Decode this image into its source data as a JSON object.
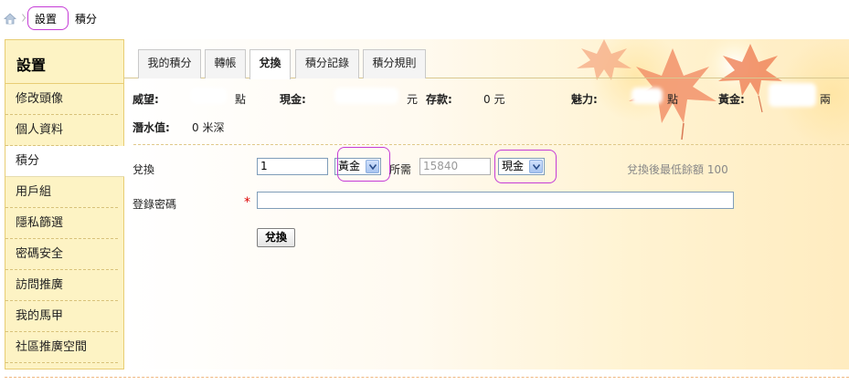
{
  "breadcrumb": {
    "items": [
      "設置",
      "積分"
    ]
  },
  "sidebar": {
    "title": "設置",
    "items": [
      {
        "label": "修改頭像"
      },
      {
        "label": "個人資料"
      },
      {
        "label": "積分",
        "active": true
      },
      {
        "label": "用戶組"
      },
      {
        "label": "隱私篩選"
      },
      {
        "label": "密碼安全"
      },
      {
        "label": "訪問推廣"
      },
      {
        "label": "我的馬甲"
      },
      {
        "label": "社區推廣空間"
      }
    ]
  },
  "tabs": [
    {
      "label": "我的積分"
    },
    {
      "label": "轉帳"
    },
    {
      "label": "兌換",
      "active": true
    },
    {
      "label": "積分記錄"
    },
    {
      "label": "積分規則"
    }
  ],
  "stats": {
    "weiwang_label": "威望:",
    "weiwang_unit": "點",
    "xianjin_label": "現金:",
    "xianjin_unit": "元",
    "cunkuan_label": "存款:",
    "cunkuan_value": "0 元",
    "meili_label": "魅力:",
    "meili_unit": "點",
    "huangjin_label": "黃金:",
    "huangjin_unit": "兩",
    "qianshui_label": "潛水值:",
    "qianshui_value": "0 米深"
  },
  "form": {
    "exchange_label": "兌換",
    "amount_value": "1",
    "from_currency": "黃金",
    "need_label": "所需",
    "need_value": "15840",
    "to_currency": "現金",
    "hint": "兌換後最低餘額 100",
    "password_label": "登錄密碼",
    "required_mark": "*",
    "password_value": "",
    "submit_label": "兌換"
  },
  "colors": {
    "sidebar_bg": "#fdf3c4",
    "highlight": "#c53bd6",
    "required": "#dd0000"
  }
}
